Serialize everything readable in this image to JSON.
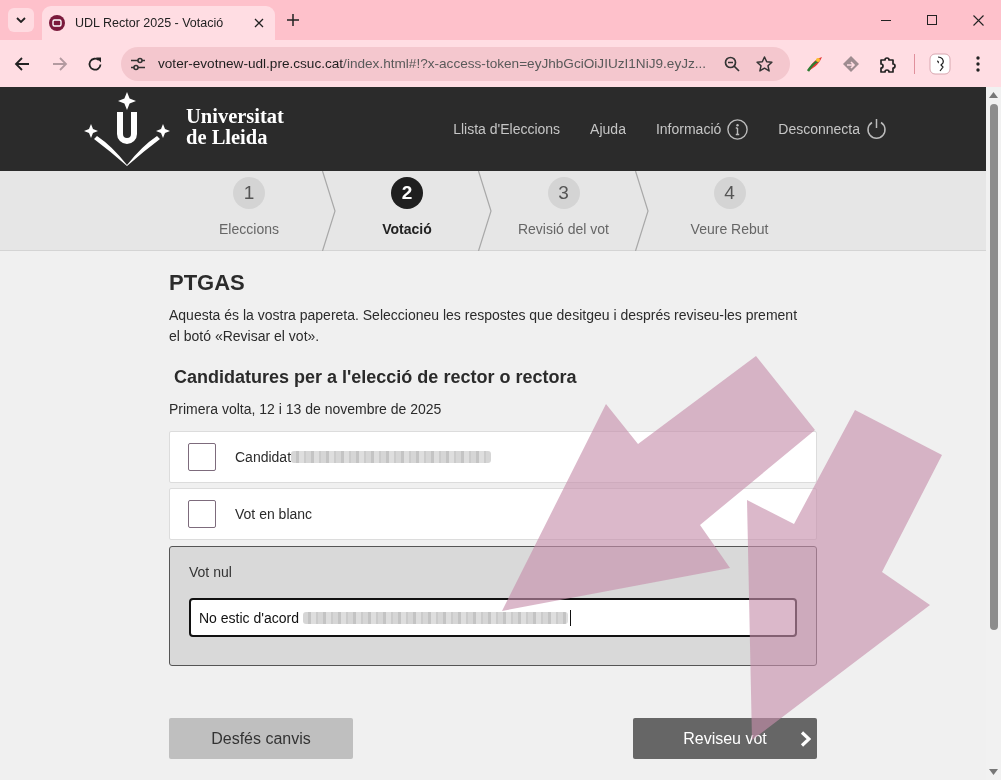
{
  "browser": {
    "tab_title": "UDL Rector 2025 - Votació",
    "url_host": "voter-evotnew-udl.pre.csuc.cat",
    "url_path": "/index.html#!?x-access-token=eyJhbGciOiJIUzI1NiJ9.eyJz...",
    "back_disabled": false,
    "forward_disabled": true
  },
  "header": {
    "logo_line_1": "Universitat",
    "logo_line_2": "de Lleida",
    "nav": [
      {
        "label": "Llista d'Eleccions",
        "kind": "link"
      },
      {
        "label": "Ajuda",
        "kind": "link"
      },
      {
        "label": "Informació",
        "kind": "info"
      },
      {
        "label": "Desconnecta",
        "kind": "logout"
      }
    ]
  },
  "steps": [
    {
      "number": "1",
      "label": "Eleccions",
      "selected": false
    },
    {
      "number": "2",
      "label": "Votació",
      "selected": true
    },
    {
      "number": "3",
      "label": "Revisió del vot",
      "selected": false
    },
    {
      "number": "4",
      "label": "Veure Rebut",
      "selected": false
    }
  ],
  "ballot": {
    "title": "PTGAS",
    "intro": "Aquesta és la vostra papereta. Seleccioneu les respostes que desitgeu i després reviseu-les prement el botó «Revisar el vot».",
    "question": "Candidatures per a l'elecció de rector o rectora",
    "round": "Primera volta, 12 i 13 de novembre de 2025",
    "options": [
      {
        "kind": "checkbox",
        "label": "Candidat",
        "redacted": true,
        "checked": false
      },
      {
        "kind": "checkbox",
        "label": "Vot en blanc",
        "redacted": false,
        "checked": false
      },
      {
        "kind": "text",
        "label": "Vot nul",
        "value": "No estic d'acord",
        "redacted": true,
        "focused": true
      }
    ]
  },
  "buttons": [
    {
      "label": "Desfés canvis",
      "kind": "secondary"
    },
    {
      "label": "Reviseu vot",
      "kind": "primary"
    }
  ]
}
